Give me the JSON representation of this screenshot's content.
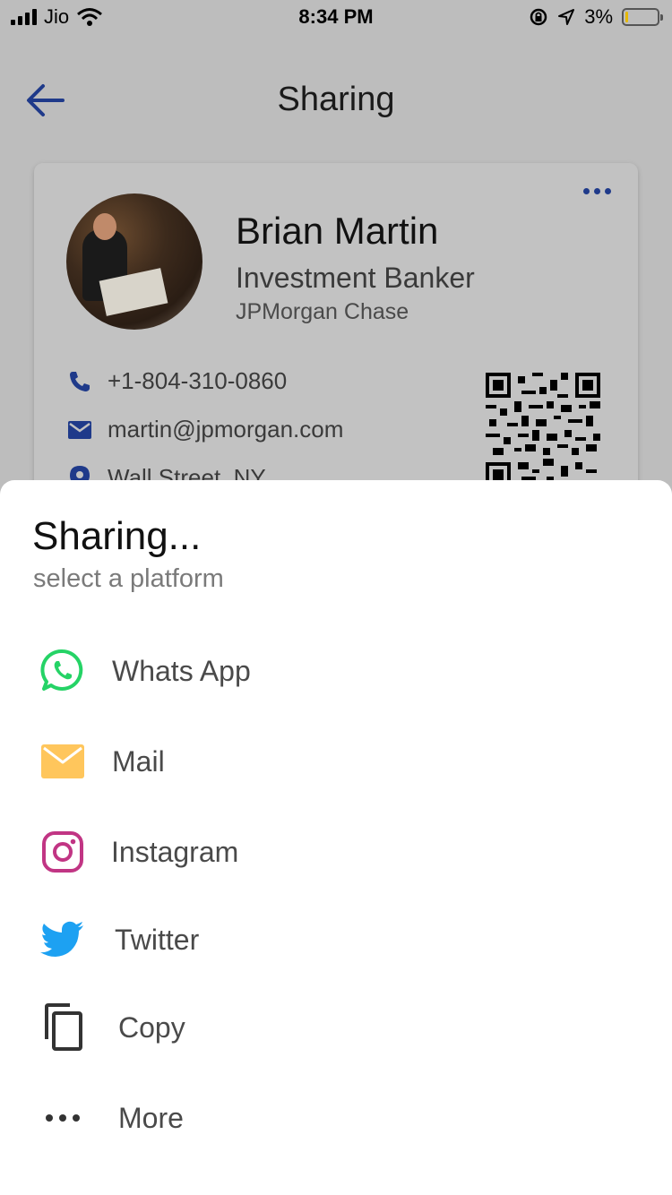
{
  "status_bar": {
    "carrier": "Jio",
    "time": "8:34 PM",
    "battery_percent": "3%",
    "battery_level": 0.03
  },
  "header": {
    "title": "Sharing",
    "back_icon": "arrow-left-icon"
  },
  "card": {
    "name": "Brian Martin",
    "role": "Investment Banker",
    "company": "JPMorgan Chase",
    "phone": "+1-804-310-0860",
    "email": "martin@jpmorgan.com",
    "address": "Wall Street, NY",
    "accent_color": "#1f3a8a"
  },
  "sheet": {
    "title": "Sharing...",
    "subtitle": "select a platform",
    "options": [
      {
        "label": "Whats App",
        "icon": "whatsapp-icon",
        "color": "#25D366"
      },
      {
        "label": "Mail",
        "icon": "mail-icon",
        "color": "#FFC65C"
      },
      {
        "label": "Instagram",
        "icon": "instagram-icon",
        "color": "#C13584"
      },
      {
        "label": "Twitter",
        "icon": "twitter-icon",
        "color": "#1DA1F2"
      },
      {
        "label": "Copy",
        "icon": "copy-icon",
        "color": "#333333"
      },
      {
        "label": "More",
        "icon": "more-dots-icon",
        "color": "#333333"
      }
    ]
  }
}
